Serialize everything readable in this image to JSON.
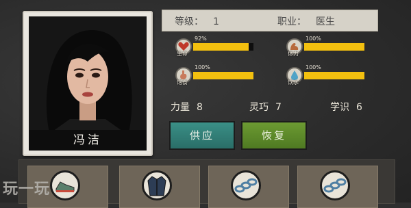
{
  "character": {
    "name": "冯洁",
    "level_label": "等级：",
    "level_value": "1",
    "job_label": "职业：",
    "job_value": "医生"
  },
  "stats": [
    {
      "label": "生命",
      "percent_text": "92%",
      "value": 0.92,
      "icon": "heart-icon"
    },
    {
      "label": "体力",
      "percent_text": "100%",
      "value": 1.0,
      "icon": "muscle-arm-icon"
    },
    {
      "label": "饱食",
      "percent_text": "100%",
      "value": 1.0,
      "icon": "stomach-icon"
    },
    {
      "label": "饮水",
      "percent_text": "100%",
      "value": 1.0,
      "icon": "water-drop-icon"
    }
  ],
  "attributes": [
    {
      "label": "力量",
      "value": "8"
    },
    {
      "label": "灵巧",
      "value": "7"
    },
    {
      "label": "学识",
      "value": "6"
    }
  ],
  "buttons": {
    "supply": "供应",
    "restore": "恢复"
  },
  "equipment_slots": [
    {
      "icon": "shoes-icon"
    },
    {
      "icon": "jacket-icon"
    },
    {
      "icon": "chain-icon"
    },
    {
      "icon": "chain-icon"
    }
  ],
  "watermark": "玩一玩",
  "colors": {
    "bar_fill": "#f3c00f",
    "supply_button": "#2f7d76",
    "restore_button": "#5f8b2a"
  }
}
